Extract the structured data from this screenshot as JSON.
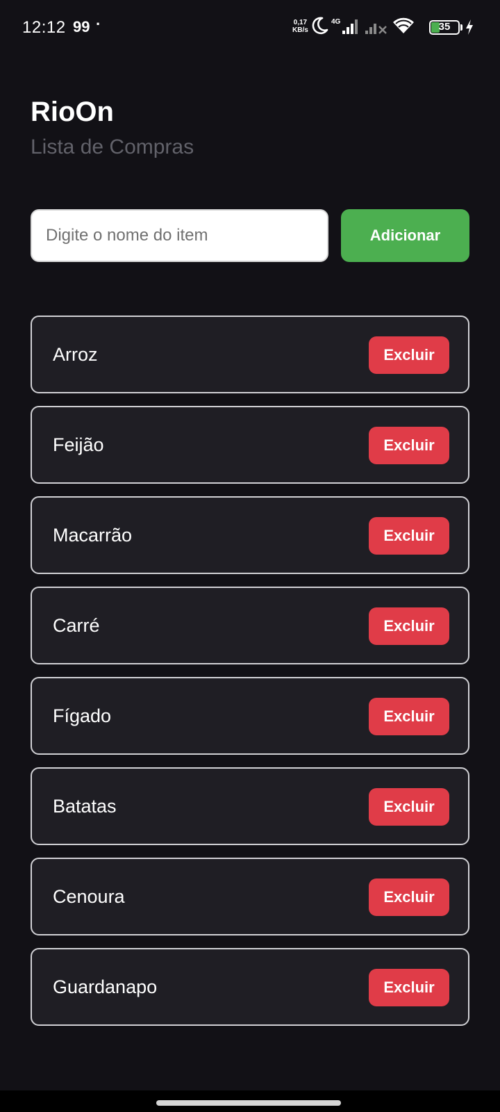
{
  "status_bar": {
    "time": "12:12",
    "notification": "99",
    "dot": "·",
    "speed_value": "0,17",
    "speed_unit": "KB/s",
    "network_type": "4G",
    "battery": "35",
    "battery_level": 0.35,
    "icons": [
      "moon-icon",
      "signal-4g-icon",
      "signal-no-sim-icon",
      "wifi-icon",
      "battery-icon",
      "charging-icon"
    ]
  },
  "header": {
    "title": "RioOn",
    "subtitle": "Lista de Compras"
  },
  "add_form": {
    "placeholder": "Digite o nome do item",
    "value": "",
    "button_label": "Adicionar"
  },
  "items": [
    {
      "name": "Arroz",
      "delete_label": "Excluir"
    },
    {
      "name": "Feijão",
      "delete_label": "Excluir"
    },
    {
      "name": "Macarrão",
      "delete_label": "Excluir"
    },
    {
      "name": "Carré",
      "delete_label": "Excluir"
    },
    {
      "name": "Fígado",
      "delete_label": "Excluir"
    },
    {
      "name": "Batatas",
      "delete_label": "Excluir"
    },
    {
      "name": "Cenoura",
      "delete_label": "Excluir"
    },
    {
      "name": "Guardanapo",
      "delete_label": "Excluir"
    }
  ],
  "colors": {
    "background": "#121116",
    "card": "#1f1e24",
    "add_button": "#4caf50",
    "delete_button": "#e03c48",
    "subtitle": "#62626a"
  }
}
